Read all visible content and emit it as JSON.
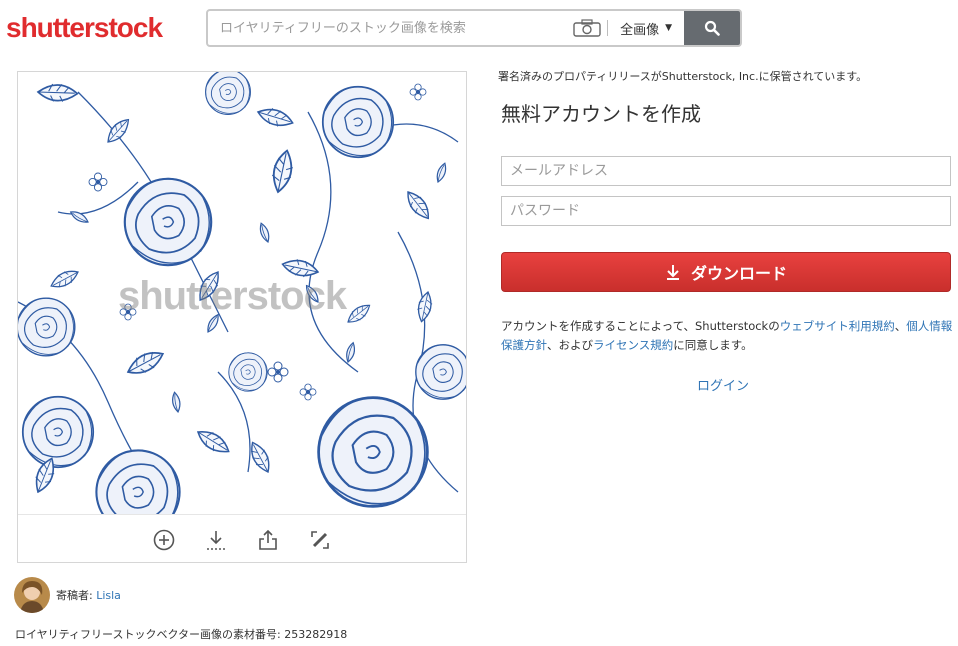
{
  "header": {
    "logo_text": "shutterstock",
    "search_placeholder": "ロイヤリティフリーのストック画像を検索",
    "image_type_selected": "全画像",
    "icons": {
      "camera": "camera-icon",
      "search": "search-icon",
      "caret": "caret-down-icon"
    }
  },
  "image_card": {
    "watermark": "shutterstock",
    "toolbar": [
      {
        "name": "add-to-collection",
        "icon": "plus-circle-icon"
      },
      {
        "name": "download",
        "icon": "download-icon"
      },
      {
        "name": "share",
        "icon": "share-icon"
      },
      {
        "name": "edit",
        "icon": "edit-icon"
      }
    ]
  },
  "contributor": {
    "label": "寄稿者: ",
    "name": "Lisla"
  },
  "asset_id_text": "ロイヤリティフリーストックベクター画像の素材番号: 253282918",
  "panel": {
    "release_note": "署名済みのプロパティリリースがShutterstock, Inc.に保管されています。",
    "title": "無料アカウントを作成",
    "email_placeholder": "メールアドレス",
    "password_placeholder": "パスワード",
    "download_label": "ダウンロード",
    "terms": {
      "part1": "アカウントを作成することによって、Shutterstockの",
      "link1": "ウェブサイト利用規約",
      "sep1": "、",
      "link2": "個人情報保護方針",
      "part2": "、および",
      "link3": "ライセンス規約",
      "part3": "に同意します。"
    },
    "login_label": "ログイン"
  },
  "colors": {
    "brand_red": "#e02c2e",
    "link_blue": "#2f74b5",
    "pattern_blue": "#2f5ba3",
    "search_button": "#666b70"
  }
}
